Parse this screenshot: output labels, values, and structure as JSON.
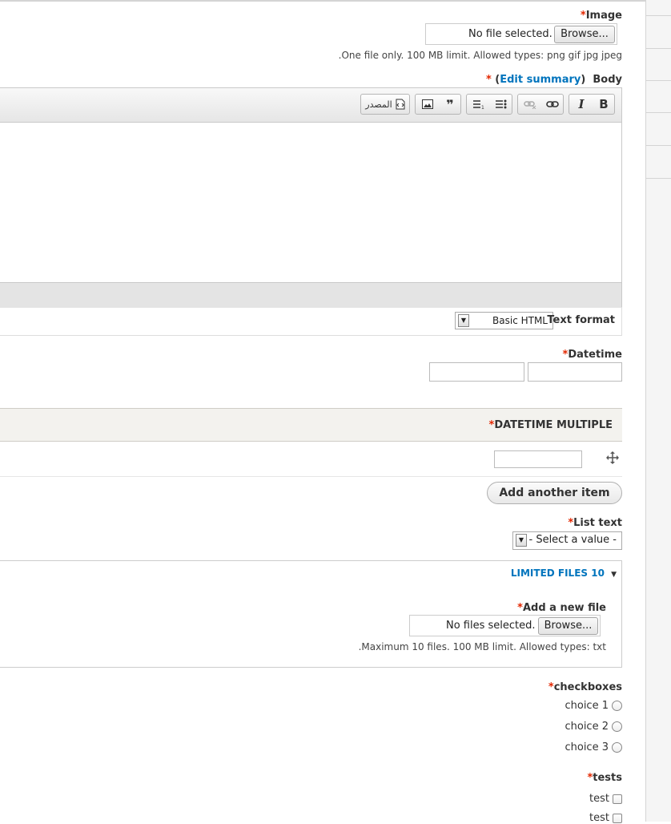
{
  "image_field": {
    "label": "Image",
    "required_mark": "*",
    "no_file_text": "No file selected.",
    "browse_label": "Browse...",
    "description": "One file only. 100 MB limit. Allowed types: png gif jpg jpeg."
  },
  "body_field": {
    "label": "Body",
    "required_mark": "*",
    "edit_summary_link": "Edit summary",
    "open_paren": "(",
    "close_paren": ")",
    "toolbar": {
      "bold": "B",
      "italic": "I",
      "source_label": "المصدر"
    }
  },
  "text_format": {
    "label": "Text format",
    "selected": "Basic HTML"
  },
  "datetime": {
    "label": "Datetime",
    "required_mark": "*"
  },
  "datetime_multiple": {
    "label": "DATETIME MULTIPLE",
    "required_mark": "*",
    "add_another_label": "Add another item"
  },
  "list_text": {
    "label": "List text",
    "required_mark": "*",
    "selected": "- Select a value -"
  },
  "limited_files": {
    "legend": "LIMITED FILES 10",
    "add_label": "Add a new file",
    "required_mark": "*",
    "no_files_text": "No files selected.",
    "browse_label": "Browse...",
    "description": "Maximum 10 files. 100 MB limit. Allowed types: txt."
  },
  "checkboxes": {
    "label": "checkboxes",
    "required_mark": "*",
    "options": [
      "choice 1",
      "choice 2",
      "choice 3"
    ]
  },
  "tests": {
    "label": "tests",
    "required_mark": "*",
    "options": [
      "test",
      "test"
    ]
  }
}
